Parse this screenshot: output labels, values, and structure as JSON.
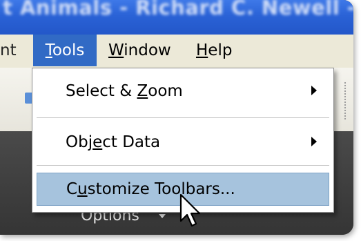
{
  "window": {
    "title": "t Animals - Richard C. Newell - A"
  },
  "menubar": {
    "partial_item": "nt",
    "tools": {
      "underline": "T",
      "rest": "ools"
    },
    "window": {
      "underline": "W",
      "rest": "indow"
    },
    "help": {
      "underline": "H",
      "rest": "elp"
    }
  },
  "dropdown": {
    "items": [
      {
        "pre": "Select & ",
        "underline": "Z",
        "post": "oom",
        "has_submenu": true
      },
      {
        "pre": "Obj",
        "underline": "e",
        "post": "ct Data",
        "has_submenu": true
      },
      {
        "pre": "C",
        "underline": "u",
        "post": "stomize Toolbars...",
        "highlighted": true
      }
    ]
  },
  "app_area": {
    "options_label": "Options"
  },
  "colors": {
    "menu_highlight": "#316ac5",
    "item_highlight": "#a6c3dd",
    "menubar_bg": "#ece9d8",
    "titlebar_blue": "#2a62d6"
  },
  "icons": {
    "submenu": "chevron-right-icon",
    "options_dropdown": "caret-down-icon",
    "cursor": "mouse-pointer-icon"
  }
}
